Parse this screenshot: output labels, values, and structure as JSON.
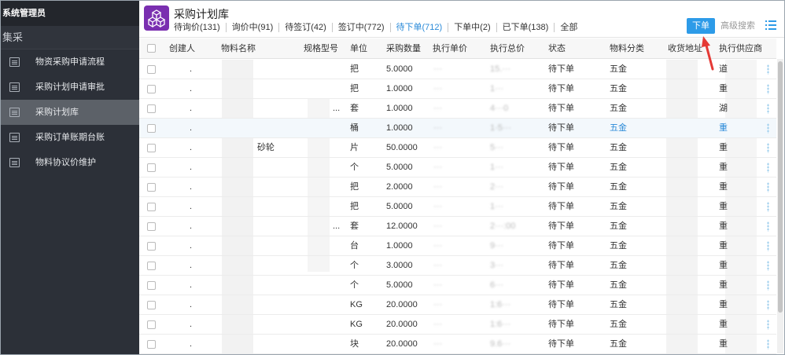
{
  "sidebar": {
    "header": "系统管理员",
    "section": "集采",
    "items": [
      {
        "label": "物资采购申请流程"
      },
      {
        "label": "采购计划申请审批"
      },
      {
        "label": "采购计划库"
      },
      {
        "label": "采购订单账期台账"
      },
      {
        "label": "物料协议价维护"
      }
    ]
  },
  "header": {
    "title": "采购计划库",
    "tabs": [
      {
        "label": "待询价(131)"
      },
      {
        "label": "询价中(91)"
      },
      {
        "label": "待签订(42)"
      },
      {
        "label": "签订中(772)"
      },
      {
        "label": "待下单(712)"
      },
      {
        "label": "下单中(2)"
      },
      {
        "label": "已下单(138)"
      },
      {
        "label": "全部"
      }
    ],
    "active_tab": "待下单(712)",
    "order_button": "下单",
    "advanced_search": "高级搜索"
  },
  "table": {
    "columns": [
      "创建人",
      "物料名称",
      "规格型号",
      "单位",
      "采购数量",
      "执行单价",
      "执行总价",
      "状态",
      "物料分类",
      "收货地址",
      "执行供应商"
    ],
    "rows": [
      {
        "creator": ".",
        "name": "",
        "spec": "",
        "unit": "把",
        "qty": "5.0000",
        "price": "···",
        "total": "15.···",
        "status": "待下单",
        "category": "五金",
        "supplier": "道"
      },
      {
        "creator": ".",
        "name": "",
        "spec": "",
        "unit": "把",
        "qty": "1.0000",
        "price": "···",
        "total": "1···",
        "status": "待下单",
        "category": "五金",
        "supplier": "重"
      },
      {
        "creator": ".",
        "name": "",
        "spec": "...",
        "unit": "套",
        "qty": "1.0000",
        "price": "···",
        "total": "4···0",
        "status": "待下单",
        "category": "五金",
        "supplier": "湖"
      },
      {
        "creator": ".",
        "name": "",
        "spec": "",
        "unit": "桶",
        "qty": "1.0000",
        "price": "···",
        "total": "1·5···",
        "status": "待下单",
        "category": "五金",
        "supplier": "重"
      },
      {
        "creator": ".",
        "name": "砂轮",
        "spec": "",
        "unit": "片",
        "qty": "50.0000",
        "price": "···",
        "total": "5···",
        "status": "待下单",
        "category": "五金",
        "supplier": "重"
      },
      {
        "creator": ".",
        "name": "",
        "spec": "",
        "unit": "个",
        "qty": "5.0000",
        "price": "···",
        "total": "1···",
        "status": "待下单",
        "category": "五金",
        "supplier": "重"
      },
      {
        "creator": ".",
        "name": "",
        "spec": "",
        "unit": "把",
        "qty": "2.0000",
        "price": "···",
        "total": "2···",
        "status": "待下单",
        "category": "五金",
        "supplier": "重"
      },
      {
        "creator": ".",
        "name": "",
        "spec": "",
        "unit": "把",
        "qty": "5.0000",
        "price": "···",
        "total": "1···",
        "status": "待下单",
        "category": "五金",
        "supplier": "重"
      },
      {
        "creator": ".",
        "name": "",
        "spec": "...",
        "unit": "套",
        "qty": "12.0000",
        "price": "···",
        "total": "2···:00",
        "status": "待下单",
        "category": "五金",
        "supplier": "重"
      },
      {
        "creator": ".",
        "name": "",
        "spec": "",
        "unit": "台",
        "qty": "1.0000",
        "price": "···",
        "total": "9···",
        "status": "待下单",
        "category": "五金",
        "supplier": "重"
      },
      {
        "creator": ".",
        "name": "",
        "spec": "",
        "unit": "个",
        "qty": "3.0000",
        "price": "···",
        "total": "3···",
        "status": "待下单",
        "category": "五金",
        "supplier": "重"
      },
      {
        "creator": ".",
        "name": "",
        "spec": "",
        "unit": "个",
        "qty": "5.0000",
        "price": "···",
        "total": "6···",
        "status": "待下单",
        "category": "五金",
        "supplier": "重"
      },
      {
        "creator": ".",
        "name": "",
        "spec": "",
        "unit": "KG",
        "qty": "20.0000",
        "price": "···",
        "total": "1:6···",
        "status": "待下单",
        "category": "五金",
        "supplier": "重"
      },
      {
        "creator": ".",
        "name": "",
        "spec": "",
        "unit": "KG",
        "qty": "20.0000",
        "price": "···",
        "total": "1:6···",
        "status": "待下单",
        "category": "五金",
        "supplier": "重"
      },
      {
        "creator": ".",
        "name": "",
        "spec": "",
        "unit": "块",
        "qty": "20.0000",
        "price": "···",
        "total": "9.6···",
        "status": "待下单",
        "category": "五金",
        "supplier": "重"
      }
    ],
    "highlight_row": 3
  },
  "colors": {
    "sidebar_bg": "#2c3038",
    "sidebar_active": "#5c6168",
    "accent": "#2d9be8",
    "logo": "#7a2fb0",
    "arrow": "#e53935"
  },
  "icons": [
    "document-icon",
    "cube-logo-icon",
    "list-view-icon",
    "checkbox-icon",
    "red-arrow-icon"
  ]
}
